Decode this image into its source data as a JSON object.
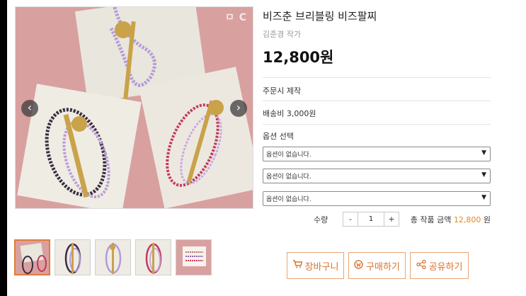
{
  "product": {
    "title": "비즈춘 브리블링 비즈팔찌",
    "author": "김준경 작가",
    "price": "12,800원",
    "made_to_order": "주문시 제작",
    "shipping": "배송비 3,000원",
    "option_heading": "옵션 선택"
  },
  "gallery": {
    "watermark": "ㅁ C",
    "prev_glyph": "‹",
    "next_glyph": "›"
  },
  "options": [
    {
      "value": "옵션이 없습니다."
    },
    {
      "value": "옵션이 없습니다."
    },
    {
      "value": "옵션이 없습니다."
    }
  ],
  "quantity": {
    "label": "수량",
    "minus": "-",
    "value": "1",
    "plus": "+"
  },
  "total": {
    "label": "총 작품 금액",
    "amount": "12,800",
    "unit": "원"
  },
  "actions": {
    "cart_label": "장바구니",
    "buy_label": "구매하기",
    "share_label": "공유하기"
  },
  "icons": {
    "cart": "cart-icon",
    "buy": "won-coin-icon",
    "share": "share-icon"
  },
  "colors": {
    "accent": "#d9732c",
    "accent_border": "#e8a474",
    "price_highlight": "#e08a2e",
    "image_background": "#d79c9c"
  }
}
